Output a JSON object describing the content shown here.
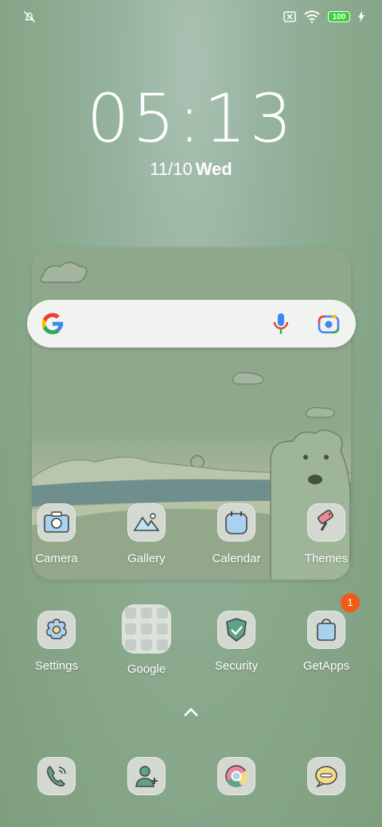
{
  "status_bar": {
    "battery": "100"
  },
  "lock": {
    "time": "05:13",
    "date": "11/10",
    "weekday": "Wed"
  },
  "widget_apps": [
    {
      "label": "Camera",
      "icon": "camera-icon"
    },
    {
      "label": "Gallery",
      "icon": "gallery-icon"
    },
    {
      "label": "Calendar",
      "icon": "calendar-icon"
    },
    {
      "label": "Themes",
      "icon": "paint-roller-icon"
    }
  ],
  "home_apps": [
    {
      "label": "Settings",
      "icon": "gear-icon"
    },
    {
      "label": "Google",
      "icon": "folder-icon"
    },
    {
      "label": "Security",
      "icon": "shield-icon"
    },
    {
      "label": "GetApps",
      "icon": "shopping-bag-icon",
      "badge": "1"
    }
  ],
  "dock": [
    {
      "icon": "phone-icon"
    },
    {
      "icon": "contacts-icon"
    },
    {
      "icon": "chrome-icon"
    },
    {
      "icon": "messages-icon"
    }
  ],
  "colors": {
    "accent_badge": "#f15a14",
    "battery": "#36d236"
  }
}
